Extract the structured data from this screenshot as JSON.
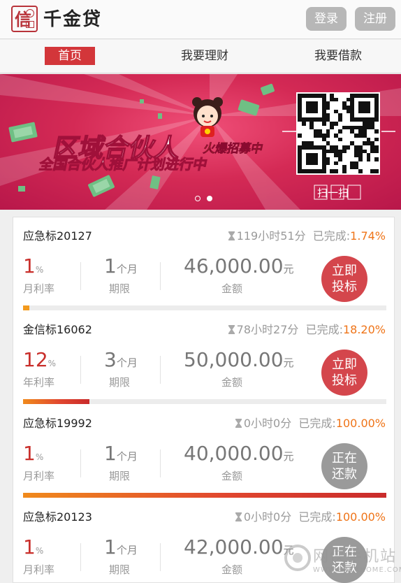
{
  "header": {
    "logo_text": "千金贷",
    "login_label": "登录",
    "register_label": "注册"
  },
  "nav": {
    "items": [
      {
        "label": "首页",
        "active": true
      },
      {
        "label": "我要理财",
        "active": false
      },
      {
        "label": "我要借款",
        "active": false
      }
    ]
  },
  "banner": {
    "title": "区域合伙人",
    "subtitle": "火爆招募中",
    "line2": "全国合伙人推广计划进行中",
    "qr_caption": "扫一扫",
    "slides": 2,
    "active_slide": 2
  },
  "loans": [
    {
      "name": "应急标20127",
      "time_left": "119小时51分",
      "done_label": "已完成:",
      "done_pct": "1.74%",
      "progress": 0.0174,
      "rate": "1",
      "rate_unit": "%",
      "rate_label": "月利率",
      "term": "1",
      "term_unit": "个月",
      "term_label": "期限",
      "amount": "46,000.00",
      "amount_unit": "元",
      "amount_label": "金额",
      "action": "立即投标",
      "action_state": "open"
    },
    {
      "name": "金信标16062",
      "time_left": "78小时27分",
      "done_label": "已完成:",
      "done_pct": "18.20%",
      "progress": 0.182,
      "rate": "12",
      "rate_unit": "%",
      "rate_label": "年利率",
      "term": "3",
      "term_unit": "个月",
      "term_label": "期限",
      "amount": "50,000.00",
      "amount_unit": "元",
      "amount_label": "金额",
      "action": "立即投标",
      "action_state": "open"
    },
    {
      "name": "应急标19992",
      "time_left": "0小时0分",
      "done_label": "已完成:",
      "done_pct": "100.00%",
      "progress": 1.0,
      "rate": "1",
      "rate_unit": "%",
      "rate_label": "月利率",
      "term": "1",
      "term_unit": "个月",
      "term_label": "期限",
      "amount": "40,000.00",
      "amount_unit": "元",
      "amount_label": "金额",
      "action": "正在还款",
      "action_state": "repaying"
    },
    {
      "name": "应急标20123",
      "time_left": "0小时0分",
      "done_label": "已完成:",
      "done_pct": "100.00%",
      "progress": 1.0,
      "rate": "1",
      "rate_unit": "%",
      "rate_label": "月利率",
      "term": "1",
      "term_unit": "个月",
      "term_label": "期限",
      "amount": "42,000.00",
      "amount_unit": "元",
      "amount_label": "金额",
      "action": "正在还款",
      "action_state": "repaying"
    }
  ],
  "watermark": {
    "text": "网侠手机站",
    "url": "WWW.HACKHOME.COM"
  },
  "colors": {
    "accent_red": "#d3363a",
    "rate_red": "#c9302c",
    "percent_orange": "#ef7418",
    "button_gray": "#b7b7b7",
    "repaying_gray": "#9a9a9a"
  }
}
